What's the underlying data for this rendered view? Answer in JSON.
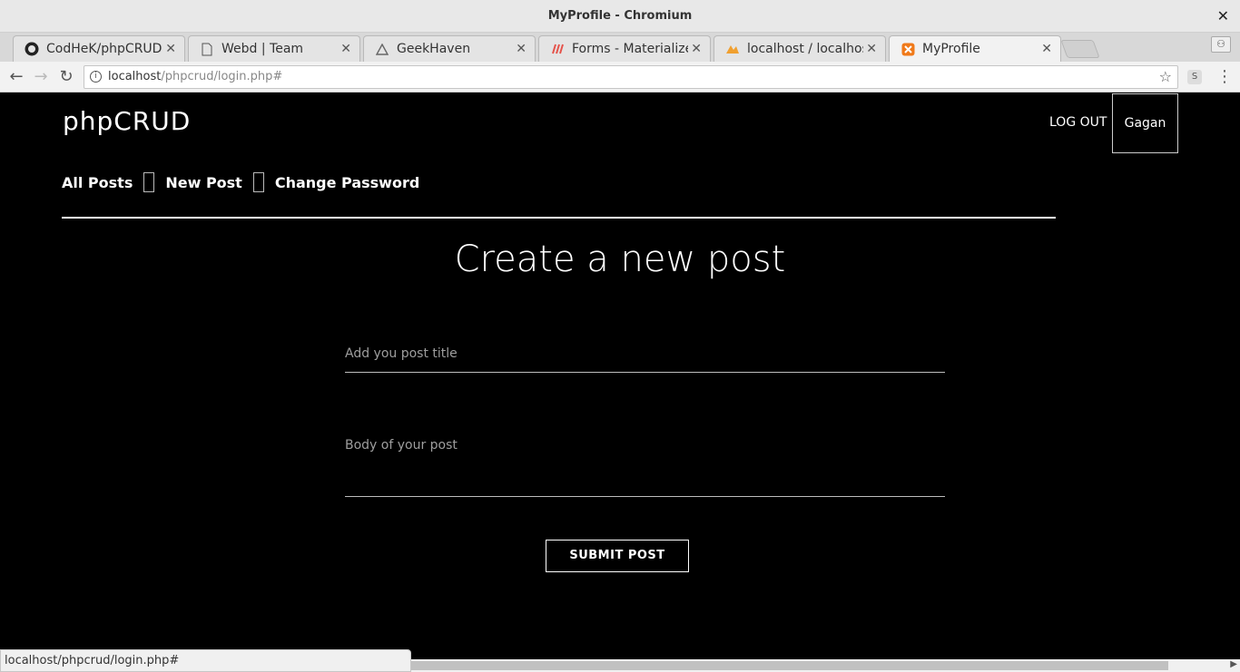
{
  "window": {
    "title": "MyProfile - Chromium"
  },
  "tabs": [
    {
      "label": "CodHeK/phpCRUD:",
      "icon": "github-icon"
    },
    {
      "label": "Webd | Team",
      "icon": "document-icon"
    },
    {
      "label": "GeekHaven",
      "icon": "triangle-logo-icon"
    },
    {
      "label": "Forms - Materialize",
      "icon": "materialize-icon"
    },
    {
      "label": "localhost / localhost",
      "icon": "phpmyadmin-icon"
    },
    {
      "label": "MyProfile",
      "icon": "xampp-icon"
    }
  ],
  "toolbar": {
    "url_host": "localhost",
    "url_path": "/phpcrud/login.php#",
    "extension_label": "S"
  },
  "page": {
    "brand": "phpCRUD",
    "logout": "LOG OUT",
    "username": "Gagan",
    "subnav": [
      "All Posts",
      "New Post",
      "Change Password"
    ],
    "heading": "Create a new post",
    "title_placeholder": "Add you post title",
    "body_placeholder": "Body of your post",
    "submit": "SUBMIT POST"
  },
  "status": {
    "url": "localhost/phpcrud/login.php#"
  }
}
